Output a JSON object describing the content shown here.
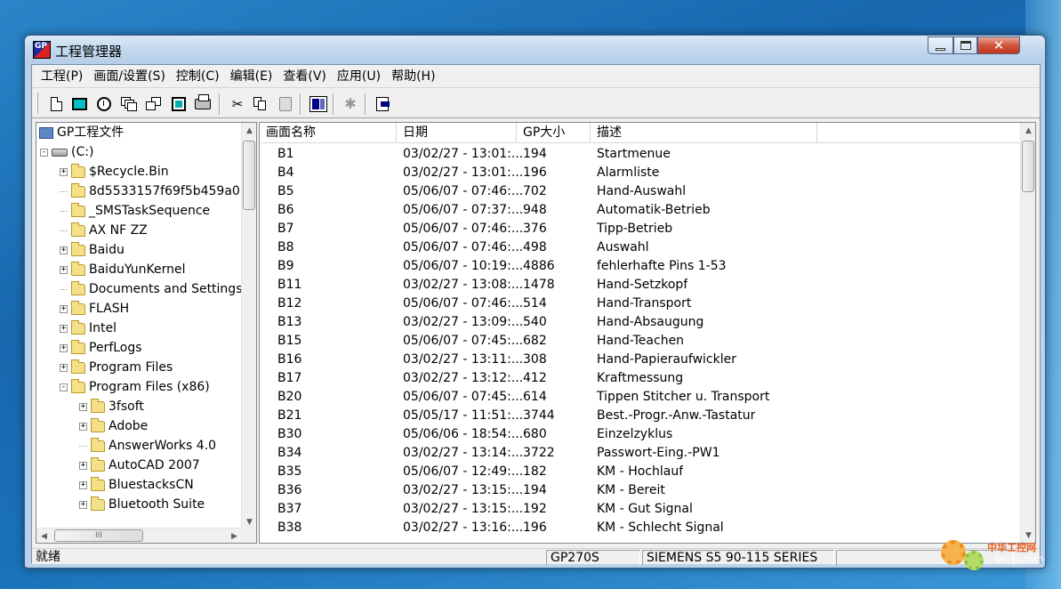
{
  "window": {
    "title": "工程管理器",
    "app_icon_text": "GP"
  },
  "menu": [
    "工程(P)",
    "画面/设置(S)",
    "控制(C)",
    "编辑(E)",
    "查看(V)",
    "应用(U)",
    "帮助(H)"
  ],
  "toolbar": {
    "icons": [
      "new-icon",
      "screen-icon",
      "alarm-icon",
      "stack-icon",
      "multi-icon",
      "window-icon",
      "print-icon",
      "cut-icon",
      "copy-icon",
      "paste-icon",
      "panel-icon",
      "settings-icon",
      "exit-icon"
    ]
  },
  "tree": {
    "root_label": "GP工程文件",
    "drive_label": "(C:)",
    "items": [
      {
        "label": "$Recycle.Bin",
        "expander": "+"
      },
      {
        "label": "8d5533157f69f5b459a0",
        "expander": ""
      },
      {
        "label": "_SMSTaskSequence",
        "expander": ""
      },
      {
        "label": "AX NF ZZ",
        "expander": ""
      },
      {
        "label": "Baidu",
        "expander": "+"
      },
      {
        "label": "BaiduYunKernel",
        "expander": "+"
      },
      {
        "label": "Documents and Settings",
        "expander": ""
      },
      {
        "label": "FLASH",
        "expander": "+"
      },
      {
        "label": "Intel",
        "expander": "+"
      },
      {
        "label": "PerfLogs",
        "expander": "+"
      },
      {
        "label": "Program Files",
        "expander": "+"
      },
      {
        "label": "Program Files (x86)",
        "expander": "-"
      }
    ],
    "subitems": [
      {
        "label": "3fsoft",
        "expander": "+"
      },
      {
        "label": "Adobe",
        "expander": "+"
      },
      {
        "label": "AnswerWorks 4.0",
        "expander": ""
      },
      {
        "label": "AutoCAD 2007",
        "expander": "+"
      },
      {
        "label": "BluestacksCN",
        "expander": "+"
      },
      {
        "label": "Bluetooth Suite",
        "expander": "+"
      }
    ],
    "scroll_thumb_label": "III"
  },
  "list": {
    "columns": [
      "画面名称",
      "日期",
      "GP大小",
      "描述"
    ],
    "rows": [
      [
        "B1",
        "03/02/27 - 13:01:...",
        "194",
        "Startmenue"
      ],
      [
        "B4",
        "03/02/27 - 13:01:...",
        "196",
        "Alarmliste"
      ],
      [
        "B5",
        "05/06/07 - 07:46:...",
        "702",
        "Hand-Auswahl"
      ],
      [
        "B6",
        "05/06/07 - 07:37:...",
        "948",
        "Automatik-Betrieb"
      ],
      [
        "B7",
        "05/06/07 - 07:46:...",
        "376",
        "Tipp-Betrieb"
      ],
      [
        "B8",
        "05/06/07 - 07:46:...",
        "498",
        "Auswahl"
      ],
      [
        "B9",
        "05/06/07 - 10:19:...",
        "4886",
        "fehlerhafte Pins 1-53"
      ],
      [
        "B11",
        "03/02/27 - 13:08:...",
        "1478",
        "Hand-Setzkopf"
      ],
      [
        "B12",
        "05/06/07 - 07:46:...",
        "514",
        "Hand-Transport"
      ],
      [
        "B13",
        "03/02/27 - 13:09:...",
        "540",
        "Hand-Absaugung"
      ],
      [
        "B15",
        "05/06/07 - 07:45:...",
        "682",
        "Hand-Teachen"
      ],
      [
        "B16",
        "03/02/27 - 13:11:...",
        "308",
        "Hand-Papieraufwickler"
      ],
      [
        "B17",
        "03/02/27 - 13:12:...",
        "412",
        "Kraftmessung"
      ],
      [
        "B20",
        "05/06/07 - 07:45:...",
        "614",
        "Tippen Stitcher u. Transport"
      ],
      [
        "B21",
        "05/05/17 - 11:51:...",
        "3744",
        "Best.-Progr.-Anw.-Tastatur"
      ],
      [
        "B30",
        "05/06/06 - 18:54:...",
        "680",
        "Einzelzyklus"
      ],
      [
        "B34",
        "03/02/27 - 13:14:...",
        "3722",
        "Passwort-Eing.-PW1"
      ],
      [
        "B35",
        "05/06/07 - 12:49:...",
        "182",
        "KM - Hochlauf"
      ],
      [
        "B36",
        "03/02/27 - 13:15:...",
        "194",
        "KM - Bereit"
      ],
      [
        "B37",
        "03/02/27 - 13:15:...",
        "192",
        "KM - Gut Signal"
      ],
      [
        "B38",
        "03/02/27 - 13:16:...",
        "196",
        "KM - Schlecht Signal"
      ]
    ]
  },
  "status": {
    "ready": "就绪",
    "model": "GP270S",
    "plc": "SIEMENS S5 90-115 SERIES"
  },
  "watermark": {
    "name": "中华工控网",
    "domain": "gkong.com"
  }
}
